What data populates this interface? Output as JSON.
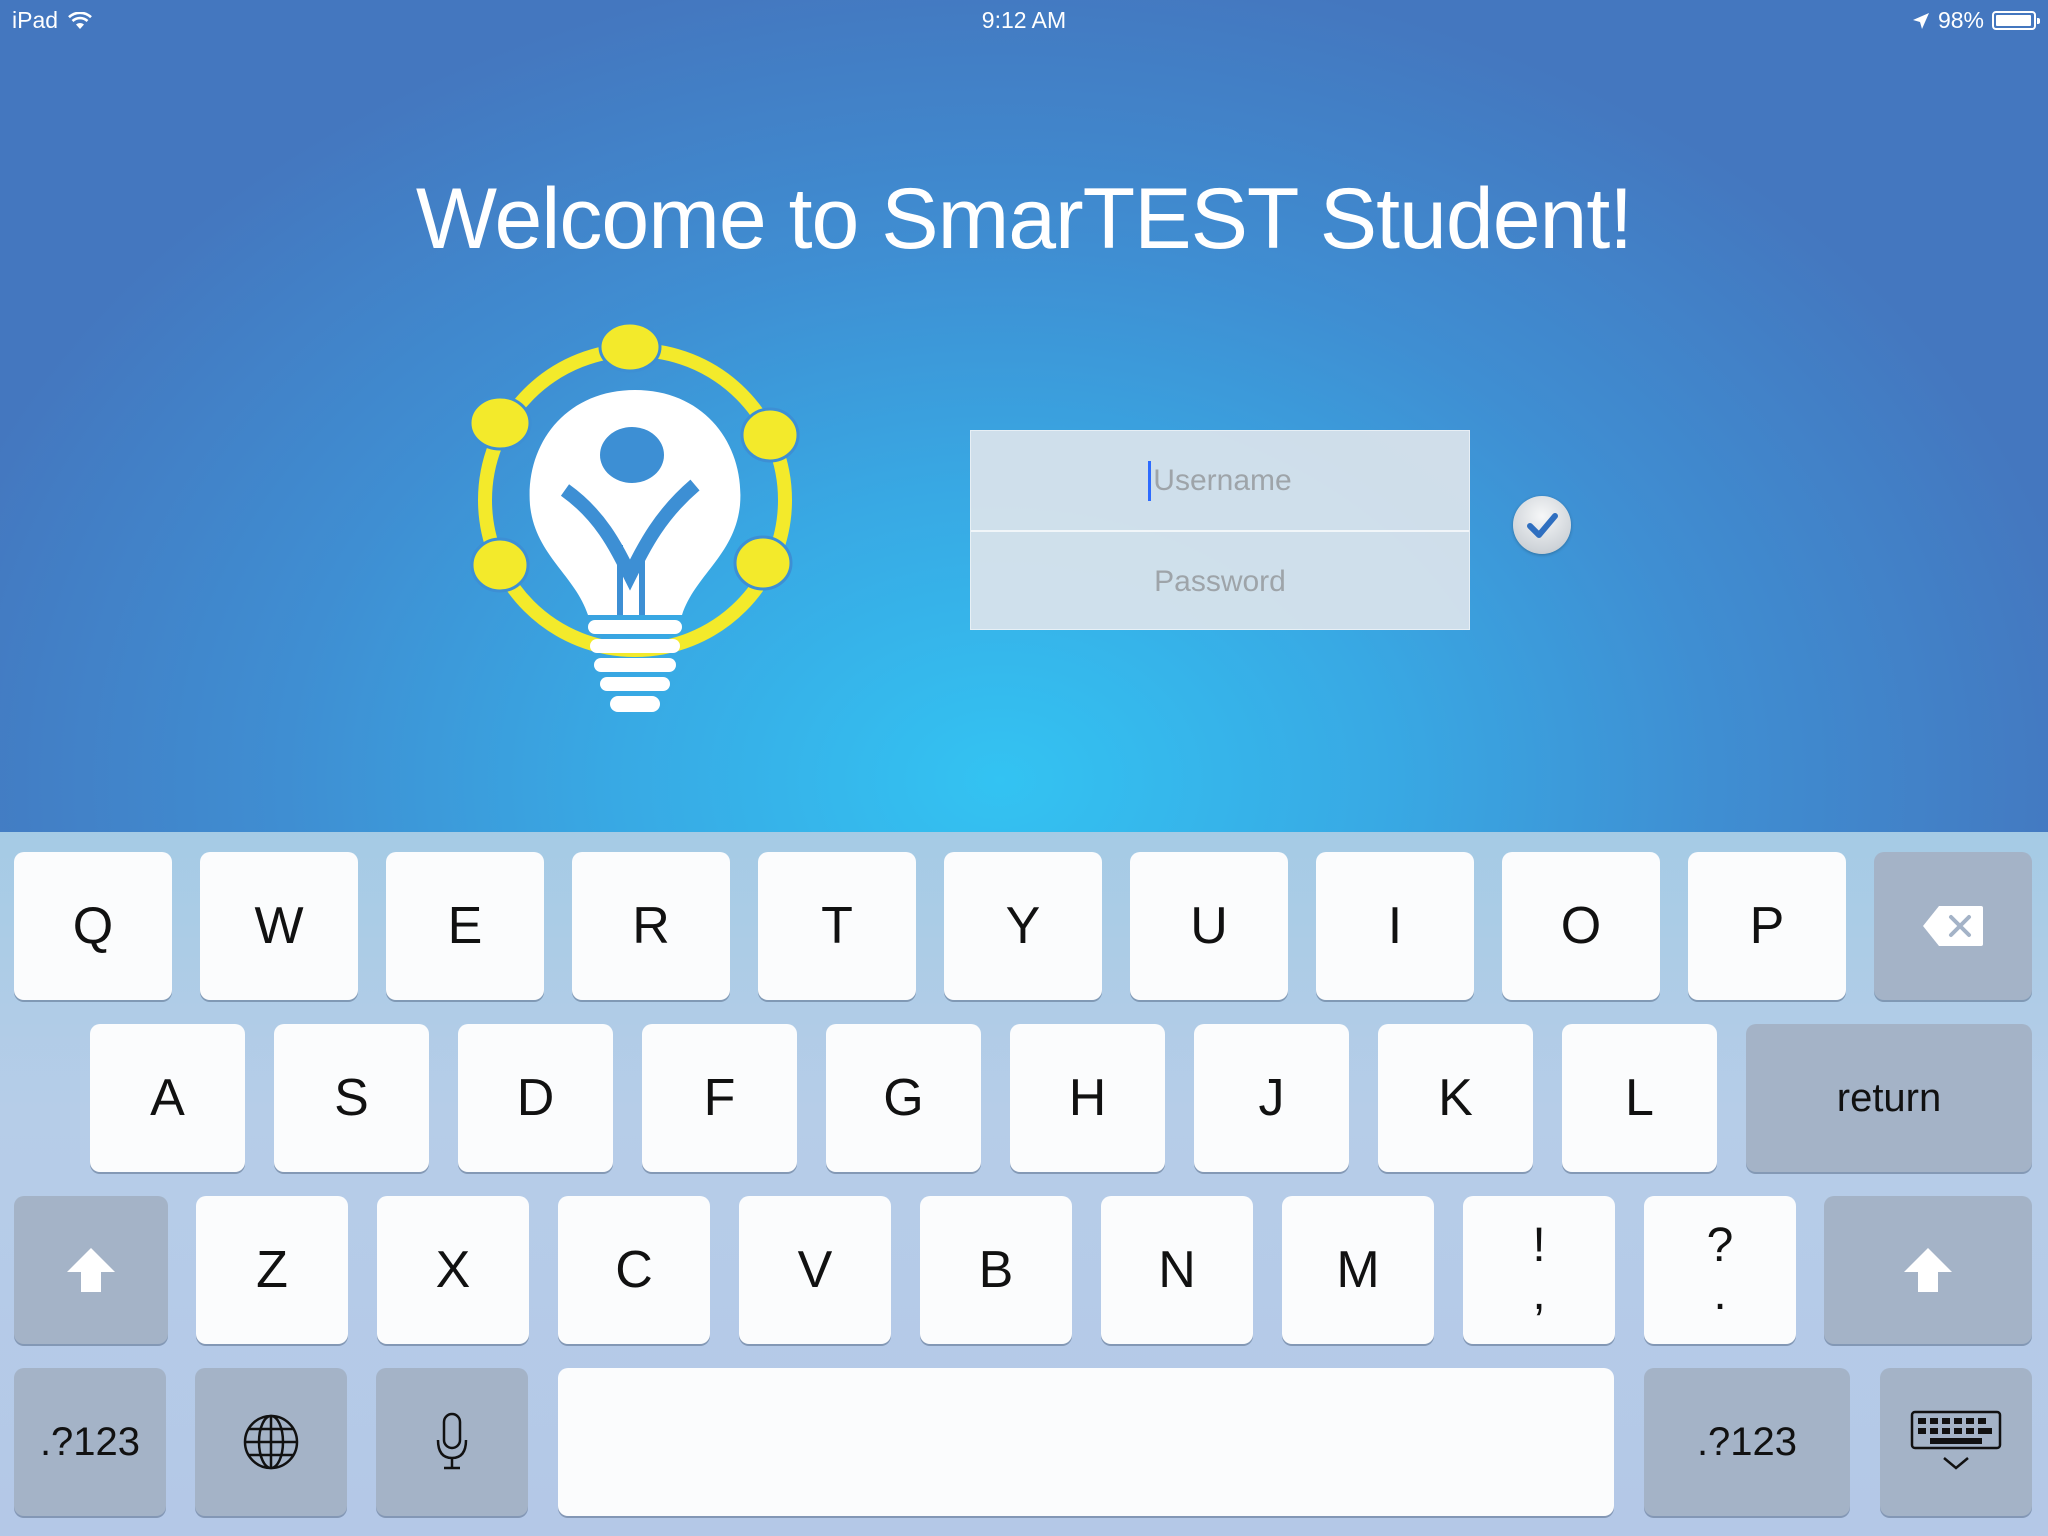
{
  "status_bar": {
    "device": "iPad",
    "time": "9:12 AM",
    "battery": "98%",
    "battery_level": 0.98
  },
  "title": "Welcome to SmarTEST Student!",
  "login": {
    "username_placeholder": "Username",
    "password_placeholder": "Password",
    "submit_icon": "checkmark-icon"
  },
  "keyboard": {
    "row1": [
      "Q",
      "W",
      "E",
      "R",
      "T",
      "Y",
      "U",
      "I",
      "O",
      "P"
    ],
    "row2": [
      "A",
      "S",
      "D",
      "F",
      "G",
      "H",
      "J",
      "K",
      "L"
    ],
    "row3": [
      "Z",
      "X",
      "C",
      "V",
      "B",
      "N",
      "M"
    ],
    "return_label": "return",
    "num_label": ".?123",
    "punct1": {
      "top": "!",
      "bottom": ","
    },
    "punct2": {
      "top": "?",
      "bottom": "."
    },
    "icons": [
      "delete-icon",
      "shift-icon",
      "globe-icon",
      "microphone-icon",
      "keyboard-dismiss-icon"
    ]
  },
  "colors": {
    "logo_yellow": "#f3ea2b",
    "accent_blue": "#3d8fd4",
    "caret": "#2d6bff"
  }
}
